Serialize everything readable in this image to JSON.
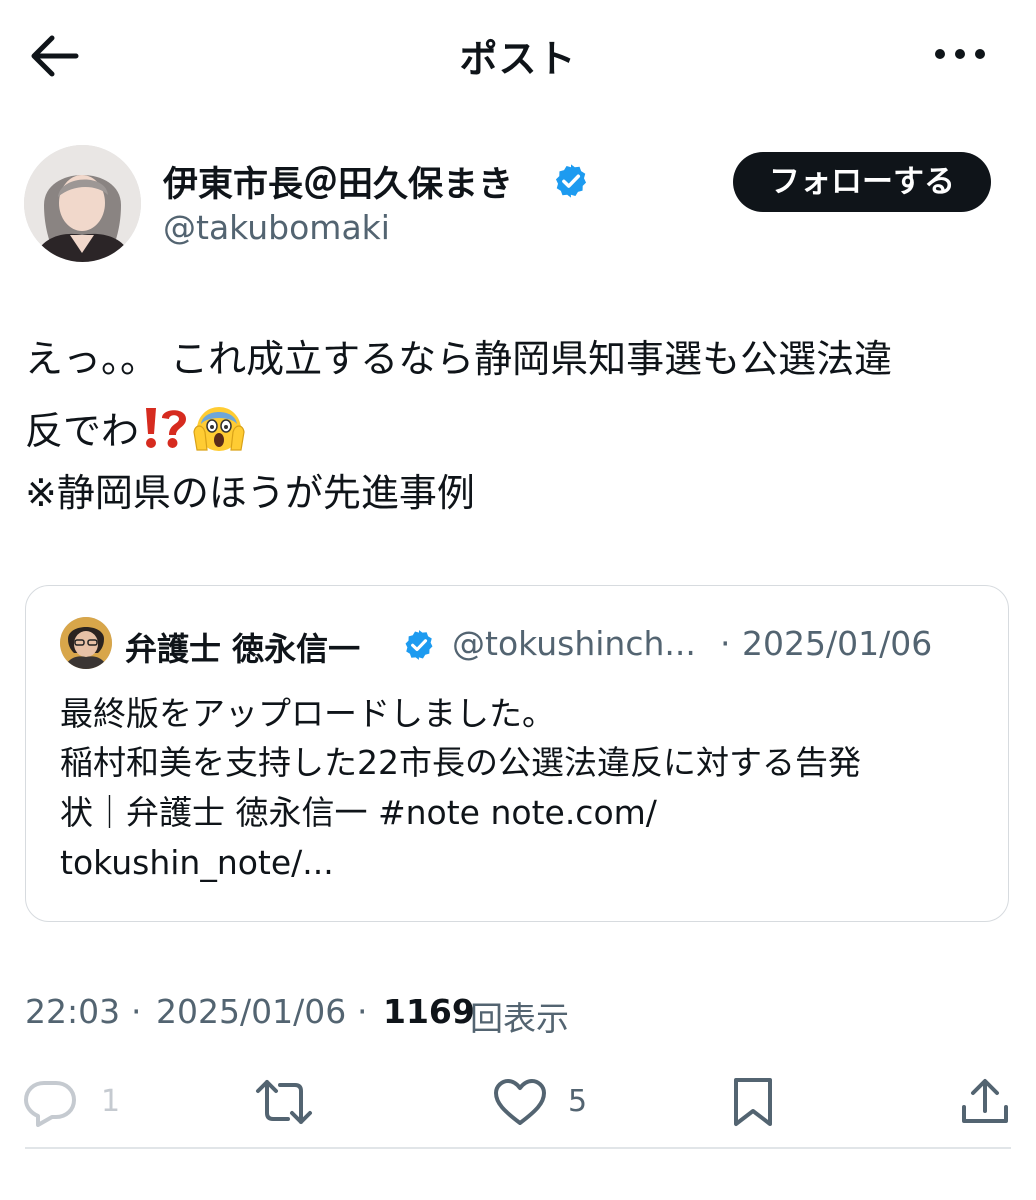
{
  "header": {
    "title": "ポスト"
  },
  "author": {
    "name": "伊東市長＠田久保まき",
    "handle": "@takubomaki",
    "follow_label": "フォローする"
  },
  "post": {
    "line1": "えっ。。 これ成立するなら静岡県知事選も公選法違",
    "line2": "反でわ",
    "line3": "※静岡県のほうが先進事例"
  },
  "quote": {
    "name": "弁護士 徳永信一",
    "handle": "@tokushinch...",
    "separator": "·",
    "date": "2025/01/06",
    "lines": [
      "最終版をアップロードしました。",
      "稲村和美を支持した22市長の公選法違反に対する告発",
      "状｜弁護士 徳永信一 #note note.com/",
      "tokushin_note/..."
    ]
  },
  "meta": {
    "time": "22:03",
    "separator": "·",
    "date": "2025/01/06",
    "views_count": "1169",
    "views_label": "回表示"
  },
  "actions": {
    "reply_count": "1",
    "like_count": "5"
  },
  "colors": {
    "text": "#0f1419",
    "secondary": "#536471",
    "verified": "#1d9bf0",
    "follow_bg": "#0f1419",
    "border": "#d7dbdf"
  },
  "icons": {
    "back": "arrow-left-icon",
    "more": "more-horizontal-icon",
    "verified": "verified-badge-icon",
    "emoji_1": "exclamation-question-mark-emoji",
    "emoji_2": "screaming-face-emoji",
    "reply": "reply-icon",
    "retweet": "retweet-icon",
    "like": "heart-icon",
    "bookmark": "bookmark-icon",
    "share": "share-icon"
  }
}
